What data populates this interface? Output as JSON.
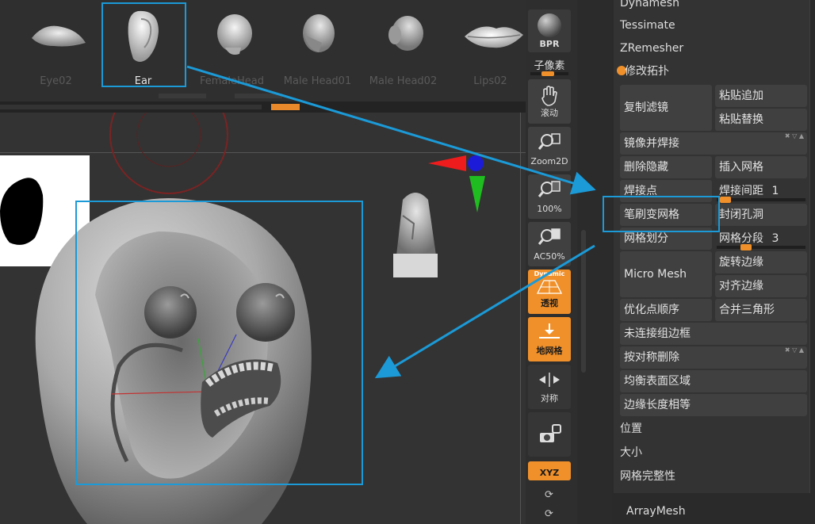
{
  "strip": {
    "models": [
      {
        "label": "Eye02"
      },
      {
        "label": "Ear"
      },
      {
        "label": "FemaleHead"
      },
      {
        "label": "Male Head01"
      },
      {
        "label": "Male Head02"
      },
      {
        "label": "Lips02"
      }
    ],
    "selected": "Ear"
  },
  "tools": {
    "bpr": "BPR",
    "subpixel_label": "子像素",
    "move": "滚动",
    "zoom2d": "Zoom2D",
    "zoom100": "100%",
    "ac50": "AC50%",
    "persp_top": "Dynamic",
    "persp": "透视",
    "floor": "地网格",
    "sym": "对称",
    "xyz": "XYZ"
  },
  "panel": {
    "top_items": [
      "Dynamesh",
      "Tessimate",
      "ZRemesher"
    ],
    "section_title": "修改拓扑",
    "buttons": {
      "copy_filter": "复制滤镜",
      "paste_append": "粘贴追加",
      "paste_replace": "粘贴替换",
      "mirror_weld": "镜像并焊接",
      "delete_hidden": "删除隐藏",
      "insert_mesh": "插入网格",
      "weld_points": "焊接点",
      "weld_dist_label": "焊接间距",
      "weld_dist_value": "1",
      "brush_to_mesh": "笔刷变网格",
      "close_holes": "封闭孔洞",
      "mesh_divide": "网格划分",
      "mesh_seg_label": "网格分段",
      "mesh_seg_value": "3",
      "micro_mesh": "Micro Mesh",
      "rotate_edge": "旋转边缘",
      "align_edge": "对齐边缘",
      "optimize_order": "优化点顺序",
      "merge_tris": "合并三角形",
      "unweld_groups": "未连接组边框",
      "delete_by_sym": "按对称删除",
      "equalize_area": "均衡表面区域",
      "equalize_edge": "边缘长度相等"
    },
    "bottom_items": [
      "位置",
      "大小",
      "网格完整性"
    ],
    "array_mesh": "ArrayMesh"
  },
  "colors": {
    "accent": "#f0902a",
    "annotation": "#1b9ad7",
    "background": "#2b2b2b"
  }
}
